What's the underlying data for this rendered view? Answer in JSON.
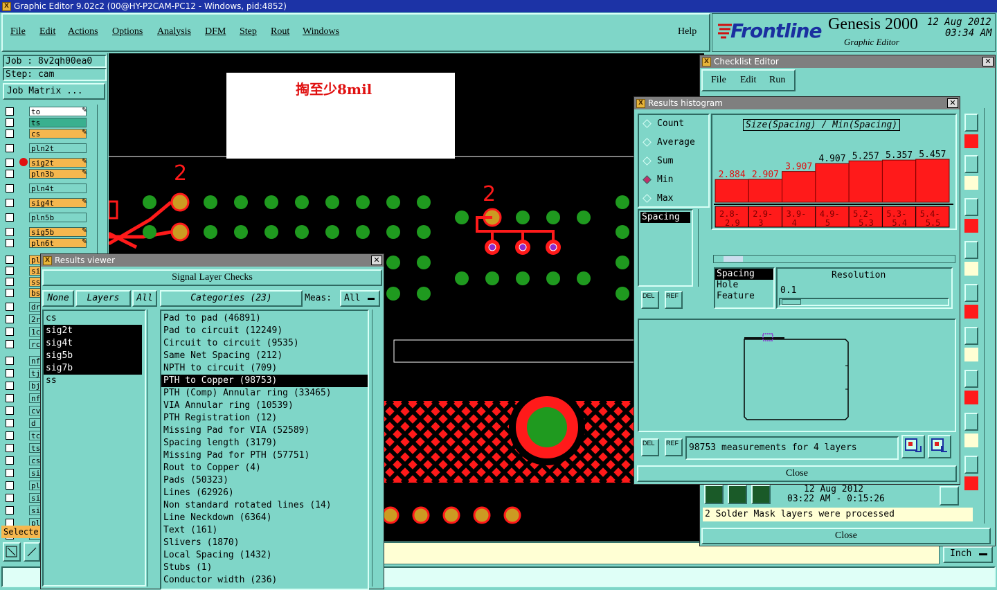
{
  "window": {
    "title": "Graphic Editor 9.02c2 (00@HY-P2CAM-PC12 - Windows, pid:4852)"
  },
  "menu": {
    "items": [
      "File",
      "Edit",
      "Actions",
      "Options",
      "Analysis",
      "DFM",
      "Step",
      "Rout",
      "Windows"
    ],
    "help": "Help"
  },
  "brand": {
    "logo": "Frontline",
    "product": "Genesis 2000",
    "subtitle": "Graphic Editor",
    "date": "12 Aug 2012",
    "time": "03:34 AM"
  },
  "job": {
    "job_label": "Job : 8v2qh00ea0",
    "step_label": "Step: cam",
    "matrix_button": "Job Matrix ..."
  },
  "layers": [
    {
      "name": "to",
      "color": "#ffffff",
      "edit": true
    },
    {
      "name": "ts",
      "color": "#3ab08f",
      "edit": false
    },
    {
      "name": "cs",
      "color": "#f5b74e",
      "edit": true
    },
    {
      "name": "pln2t",
      "color": "#7fd6c8",
      "edit": false
    },
    {
      "name": "sig2t",
      "color": "#f5b74e",
      "edit": true,
      "dot": true
    },
    {
      "name": "pln3b",
      "color": "#f5b74e",
      "edit": true
    },
    {
      "name": "pln4t",
      "color": "#7fd6c8",
      "edit": false
    },
    {
      "name": "sig4t",
      "color": "#f5b74e",
      "edit": true
    },
    {
      "name": "pln5b",
      "color": "#7fd6c8",
      "edit": false
    },
    {
      "name": "sig5b",
      "color": "#f5b74e",
      "edit": true
    },
    {
      "name": "pln6t",
      "color": "#f5b74e",
      "edit": true
    }
  ],
  "layers_short": [
    "pl",
    "si",
    "ss",
    "bs",
    "dr",
    "2r",
    "1c",
    "rc",
    "nf",
    "tj",
    "bj",
    "nf",
    "cv",
    "d",
    "tc",
    "ts",
    "cs",
    "si",
    "pl",
    "si",
    "si",
    "pl",
    "si"
  ],
  "selected_label": "Selecte",
  "canvas": {
    "note": "掏至少8mil",
    "marker_a": "2",
    "marker_b": "2"
  },
  "results_viewer": {
    "title": "Results viewer",
    "heading": "Signal Layer Checks",
    "none_btn": "None",
    "layers_btn": "Layers",
    "all_btn": "All",
    "categories_btn": "Categories (23)",
    "meas_label": "Meas:",
    "meas_value": "All",
    "layers": [
      "cs",
      "sig2t",
      "sig4t",
      "sig5b",
      "sig7b",
      "ss"
    ],
    "selected_layers": [
      1,
      2,
      3,
      4
    ],
    "categories": [
      "Pad to pad (46891)",
      "Pad to circuit (12249)",
      "Circuit to circuit (9535)",
      "Same Net Spacing (212)",
      "NPTH to circuit (709)",
      "PTH to Copper (98753)",
      "PTH (Comp) Annular ring (33465)",
      "VIA Annular ring (10539)",
      "PTH Registration (12)",
      "Missing Pad for VIA (52589)",
      "Spacing length (3179)",
      "Missing Pad for PTH (57751)",
      "Rout to Copper (4)",
      "Pads (50323)",
      "Lines (62926)",
      "Non standard rotated lines (14)",
      "Line Neckdown (6364)",
      "Text (161)",
      "Slivers (1870)",
      "Local Spacing (1432)",
      "Stubs (1)",
      "Conductor width (236)"
    ],
    "selected_category": 5
  },
  "checklist": {
    "title": "Checklist Editor",
    "menu": [
      "File",
      "Edit",
      "Run"
    ],
    "date": "12 Aug 2012",
    "time": "03:22 AM - 0:15:26",
    "status": "2 Solder Mask layers were processed",
    "close": "Close"
  },
  "histogram": {
    "title": "Results histogram",
    "modes": [
      "Count",
      "Average",
      "Sum",
      "Min",
      "Max"
    ],
    "selected_mode": 3,
    "chart_title": "Size(Spacing) / Min(Spacing)",
    "measure_list": [
      "Spacing"
    ],
    "del": "DEL",
    "ref": "REF",
    "sort_list": [
      "Spacing",
      "Hole",
      "Feature"
    ],
    "resolution_label": "Resolution",
    "resolution_value": "0.1",
    "summary": "98753 measurements for 4 layers",
    "close": "Close",
    "chart_data": {
      "type": "bar",
      "categories": [
        "2.8-2.9",
        "2.9-3",
        "3.9-4",
        "4.9-5",
        "5.2-5.3",
        "5.3-5.4",
        "5.4-5.5"
      ],
      "values": [
        2.884,
        2.907,
        3.907,
        4.907,
        5.257,
        5.357,
        5.457
      ],
      "value_labels": [
        "2.884",
        "2.907",
        "3.907",
        "4.907",
        "5.257",
        "5.357",
        "5.457"
      ],
      "title": "Size(Spacing) / Min(Spacing)",
      "ylim": [
        0,
        5.457
      ],
      "color": "#ff1a1a"
    }
  },
  "units": "Inch"
}
